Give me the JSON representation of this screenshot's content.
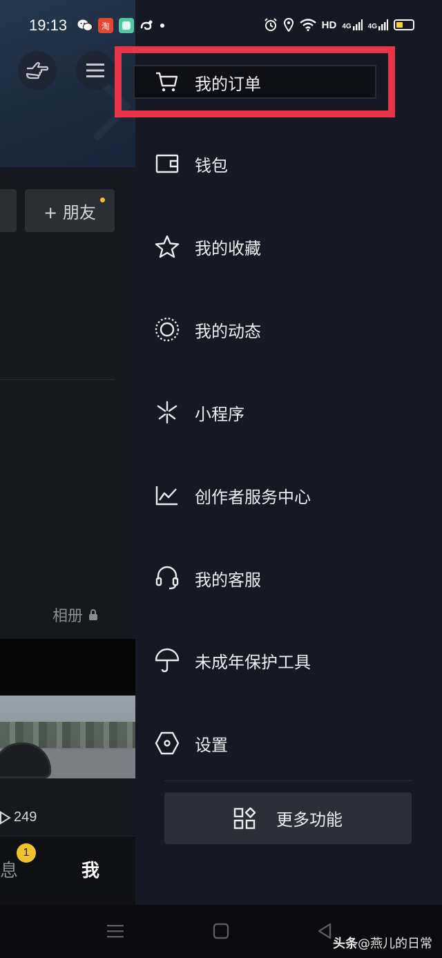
{
  "status_bar": {
    "time": "19:13",
    "network_label": "HD",
    "signal_labels": [
      "4G",
      "4G"
    ],
    "colors": {
      "taobao": "#e8432c",
      "battery_fill": "#f4d13d"
    }
  },
  "profile_background": {
    "add_friend_label": "+ 朋友",
    "album_label": "相册",
    "video_views": "249",
    "tab_messages_label": "息",
    "tab_messages_badge": "1",
    "tab_me_label": "我"
  },
  "drawer": {
    "menu_items": [
      {
        "label": "我的订单",
        "icon": "cart-icon"
      },
      {
        "label": "钱包",
        "icon": "wallet-icon"
      },
      {
        "label": "我的收藏",
        "icon": "star-icon"
      },
      {
        "label": "我的动态",
        "icon": "circle-dashed-icon"
      },
      {
        "label": "小程序",
        "icon": "asterisk-icon"
      },
      {
        "label": "创作者服务中心",
        "icon": "chart-line-icon"
      },
      {
        "label": "我的客服",
        "icon": "headset-icon"
      },
      {
        "label": "未成年保护工具",
        "icon": "umbrella-icon"
      },
      {
        "label": "设置",
        "icon": "hexagon-icon"
      }
    ],
    "more_button_label": "更多功能",
    "highlight_color": "#e8354a"
  },
  "watermark": {
    "brand": "头条",
    "handle": "@燕儿的日常"
  }
}
